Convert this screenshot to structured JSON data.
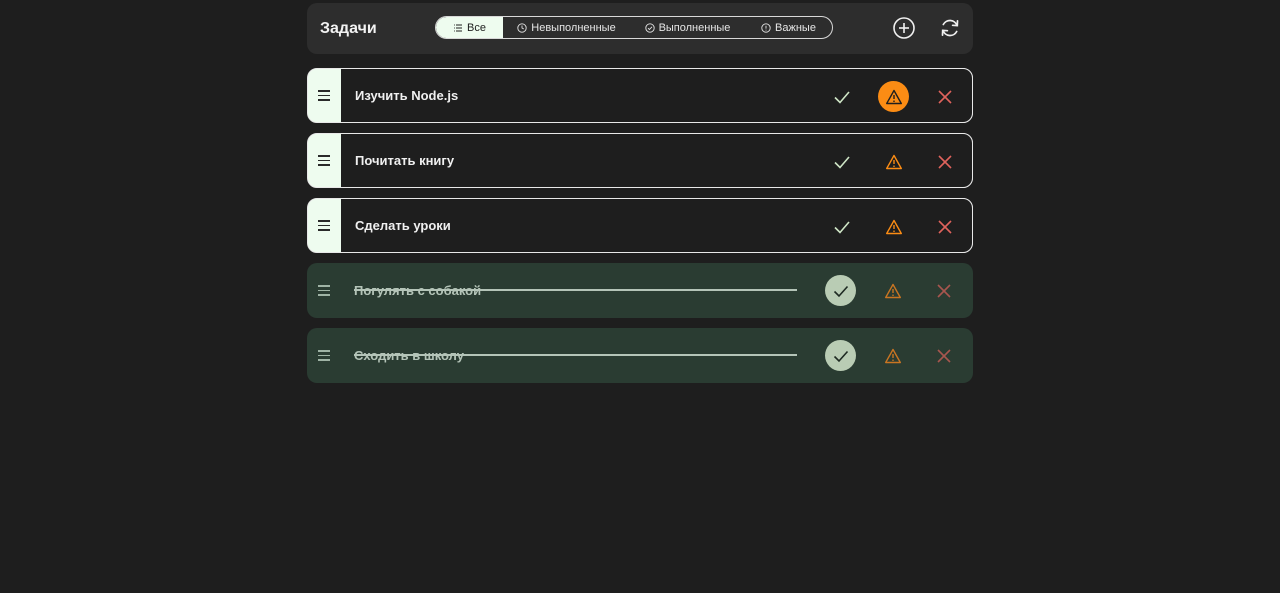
{
  "header": {
    "title": "Задачи",
    "filters": [
      {
        "label": "Все",
        "icon": "list-icon",
        "active": true
      },
      {
        "label": "Невыполненные",
        "icon": "clock-icon",
        "active": false
      },
      {
        "label": "Выполненные",
        "icon": "check-circle-icon",
        "active": false
      },
      {
        "label": "Важные",
        "icon": "info-circle-icon",
        "active": false
      }
    ],
    "add_icon": "plus-circle-icon",
    "refresh_icon": "refresh-icon"
  },
  "tasks": [
    {
      "label": "Изучить Node.js",
      "done": false,
      "important": true
    },
    {
      "label": "Почитать книгу",
      "done": false,
      "important": false
    },
    {
      "label": "Сделать уроки",
      "done": false,
      "important": false
    },
    {
      "label": "Погулять с собакой",
      "done": true,
      "important": false
    },
    {
      "label": "Сходить в школу",
      "done": true,
      "important": false
    }
  ],
  "colors": {
    "background": "#1e1e1e",
    "header": "#2d2d2d",
    "accent_light": "#eefcef",
    "done_row": "#2a3c32",
    "check": "#cfe6c6",
    "warning": "#fb8c14",
    "delete": "#e0635c"
  }
}
